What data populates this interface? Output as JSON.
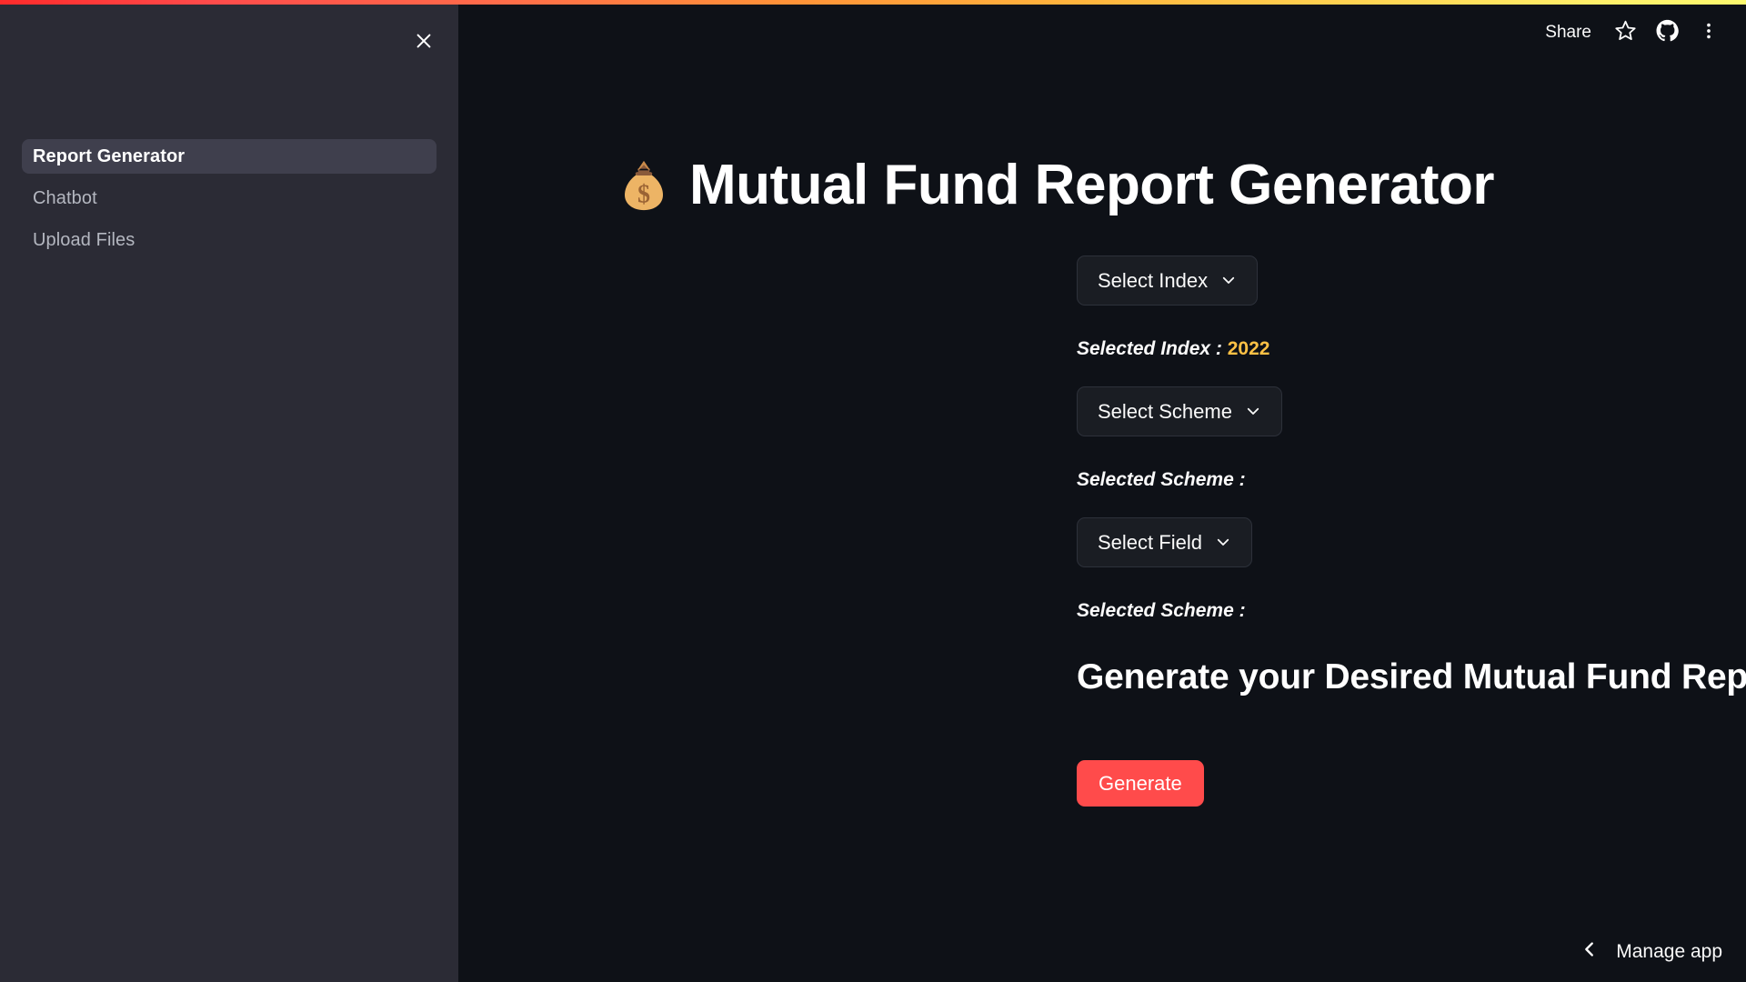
{
  "app": {
    "accent_color": "#ff4b4b",
    "background_color": "#0e1117",
    "sidebar_color": "#2b2b35",
    "highlight_color": "#ffc145"
  },
  "toolbar": {
    "share_label": "Share",
    "star_icon": "star-icon",
    "github_icon": "github-icon",
    "overflow_icon": "more-vertical-icon"
  },
  "sidebar": {
    "close_icon": "close-icon",
    "items": [
      {
        "label": "Report Generator",
        "active": true
      },
      {
        "label": "Chatbot",
        "active": false
      },
      {
        "label": "Upload Files",
        "active": false
      }
    ]
  },
  "main": {
    "title_emoji": "money-bag-emoji",
    "title": "Mutual Fund Report Generator",
    "controls": [
      {
        "button_label": "Select Index",
        "icon": "chevron-down-icon",
        "result_label": "Selected Index :",
        "result_value": "2022"
      },
      {
        "button_label": "Select Scheme",
        "icon": "chevron-down-icon",
        "result_label": "Selected Scheme :",
        "result_value": ""
      },
      {
        "button_label": "Select Field",
        "icon": "chevron-down-icon",
        "result_label": "Selected Scheme :",
        "result_value": ""
      }
    ],
    "section_heading": "Generate your Desired Mutual Fund Report",
    "generate_label": "Generate"
  },
  "footer": {
    "manage_app_label": "Manage app",
    "chevron_icon": "chevron-left-icon"
  }
}
